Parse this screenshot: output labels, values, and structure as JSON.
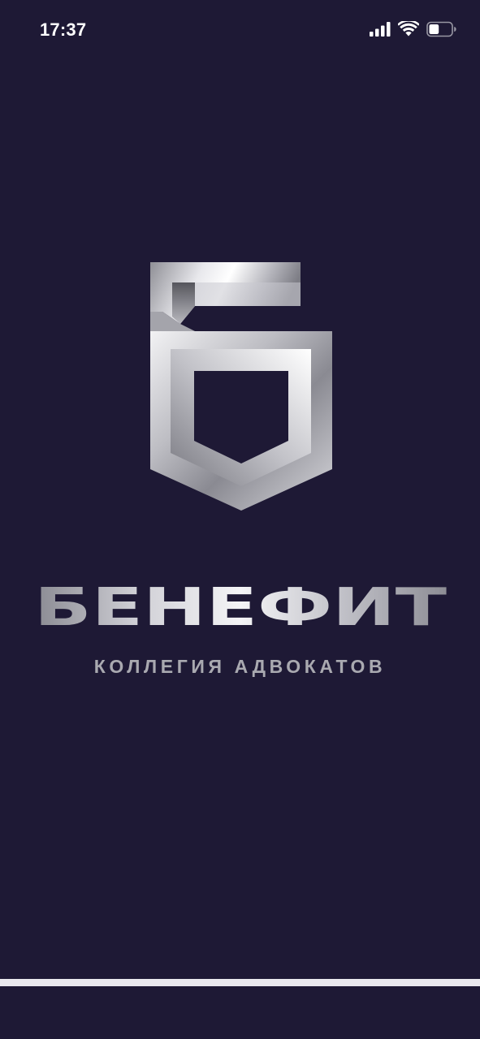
{
  "status_bar": {
    "time": "17:37",
    "icons": [
      "cellular-signal-icon",
      "wifi-icon",
      "battery-icon"
    ],
    "battery_level": 0.45
  },
  "brand": {
    "name": "БЕНЕФИТ",
    "tagline": "КОЛЛЕГИЯ АДВОКАТОВ",
    "logo_icon": "benefit-shield-logo-icon"
  },
  "colors": {
    "background": "#1e1935",
    "metal_light": "#ffffff",
    "metal_mid": "#c9c9cf",
    "metal_dark": "#6e6e76",
    "tagline": "#a9a9b0",
    "home_indicator": "#e9e8ee"
  }
}
